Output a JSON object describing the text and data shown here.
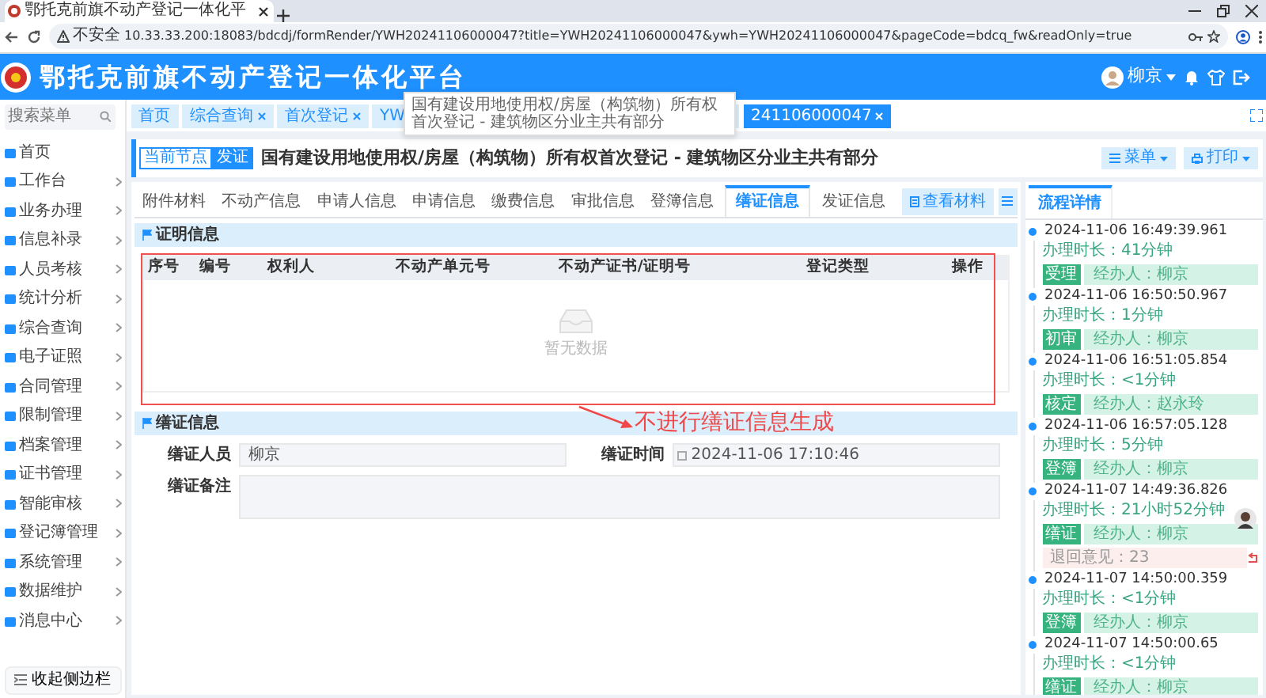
{
  "browser": {
    "tab_title": "鄂托克前旗不动产登记一体化平",
    "security": "不安全",
    "url": "10.33.33.200:18083/bdcdj/formRender/YWH20241106000047?title=YWH20241106000047&ywh=YWH20241106000047&pageCode=bdcq_fw&readOnly=true"
  },
  "header": {
    "title": "鄂托克前旗不动产登记一体化平台",
    "user": "柳京"
  },
  "sidebar": {
    "search": {
      "placeholder": "搜索菜单"
    },
    "items": [
      {
        "label": "首页",
        "expandable": false
      },
      {
        "label": "工作台",
        "expandable": true
      },
      {
        "label": "业务办理",
        "expandable": true
      },
      {
        "label": "信息补录",
        "expandable": true
      },
      {
        "label": "人员考核",
        "expandable": true
      },
      {
        "label": "统计分析",
        "expandable": true
      },
      {
        "label": "综合查询",
        "expandable": true
      },
      {
        "label": "电子证照",
        "expandable": true
      },
      {
        "label": "合同管理",
        "expandable": true
      },
      {
        "label": "限制管理",
        "expandable": true
      },
      {
        "label": "档案管理",
        "expandable": true
      },
      {
        "label": "证书管理",
        "expandable": true
      },
      {
        "label": "智能审核",
        "expandable": true
      },
      {
        "label": "登记簿管理",
        "expandable": true
      },
      {
        "label": "系统管理",
        "expandable": true
      },
      {
        "label": "数据维护",
        "expandable": true
      },
      {
        "label": "消息中心",
        "expandable": true
      }
    ],
    "collapse": "收起侧边栏"
  },
  "page_tabs": [
    {
      "label": "首页",
      "closable": false,
      "selected": false
    },
    {
      "label": "综合查询",
      "closable": true,
      "selected": false
    },
    {
      "label": "首次登记",
      "closable": true,
      "selected": false
    },
    {
      "label": "YW",
      "closable": false,
      "selected": false
    },
    {
      "label": "241106000047",
      "closable": true,
      "selected": true
    }
  ],
  "tooltip": "国有建设用地使用权/房屋（构筑物）所有权首次登记 - 建筑物区分业主共有部分",
  "node": {
    "label": "当前节点",
    "value": "发证"
  },
  "title": "国有建设用地使用权/房屋（构筑物）所有权首次登记 - 建筑物区分业主共有部分",
  "actions": [
    "菜单",
    "打印"
  ],
  "form_tabs": [
    {
      "label": "附件材料",
      "selected": false
    },
    {
      "label": "不动产信息",
      "selected": false
    },
    {
      "label": "申请人信息",
      "selected": false
    },
    {
      "label": "申请信息",
      "selected": false
    },
    {
      "label": "缴费信息",
      "selected": false
    },
    {
      "label": "审批信息",
      "selected": false
    },
    {
      "label": "登簿信息",
      "selected": false
    },
    {
      "label": "缮证信息",
      "selected": true
    },
    {
      "label": "发证信息",
      "selected": false
    }
  ],
  "view_materials": "查看材料",
  "certificate_section": {
    "title": "证明信息",
    "columns": [
      "序号",
      "编号",
      "权利人",
      "不动产单元号",
      "不动产证书/证明号",
      "登记类型",
      "操作"
    ],
    "empty": "暂无数据"
  },
  "annotation": "不进行缮证信息生成",
  "issue_section": {
    "title": "缮证信息",
    "fields": [
      {
        "label": "缮证人员",
        "value": "柳京",
        "kind": "text"
      },
      {
        "label": "缮证时间",
        "value": "2024-11-06 17:10:46",
        "kind": "date"
      },
      {
        "label": "缮证备注",
        "kind": "textarea"
      }
    ]
  },
  "flow": {
    "tab": "流程详情",
    "steps": [
      {
        "time": "2024-11-06 16:49:39.961",
        "duration": "办理时长：41分钟",
        "node": "受理",
        "handler": "经办人：柳京"
      },
      {
        "time": "2024-11-06 16:50:50.967",
        "duration": "办理时长：1分钟",
        "node": "初审",
        "handler": "经办人：柳京"
      },
      {
        "time": "2024-11-06 16:51:05.854",
        "duration": "办理时长：<1分钟",
        "node": "核定",
        "handler": "经办人：赵永玲"
      },
      {
        "time": "2024-11-06 16:57:05.128",
        "duration": "办理时长：5分钟",
        "node": "登簿",
        "handler": "经办人：柳京"
      },
      {
        "time": "2024-11-07 14:49:36.826",
        "duration": "办理时长：21小时52分钟",
        "node": "缮证",
        "handler": "经办人：柳京",
        "note": "退回意见：23"
      },
      {
        "time": "2024-11-07 14:50:00.359",
        "duration": "办理时长：<1分钟",
        "node": "登簿",
        "handler": "经办人：柳京"
      },
      {
        "time": "2024-11-07 14:50:00.65",
        "duration": "办理时长：<1分钟",
        "node": "缮证",
        "handler": "经办人：柳京"
      }
    ]
  }
}
